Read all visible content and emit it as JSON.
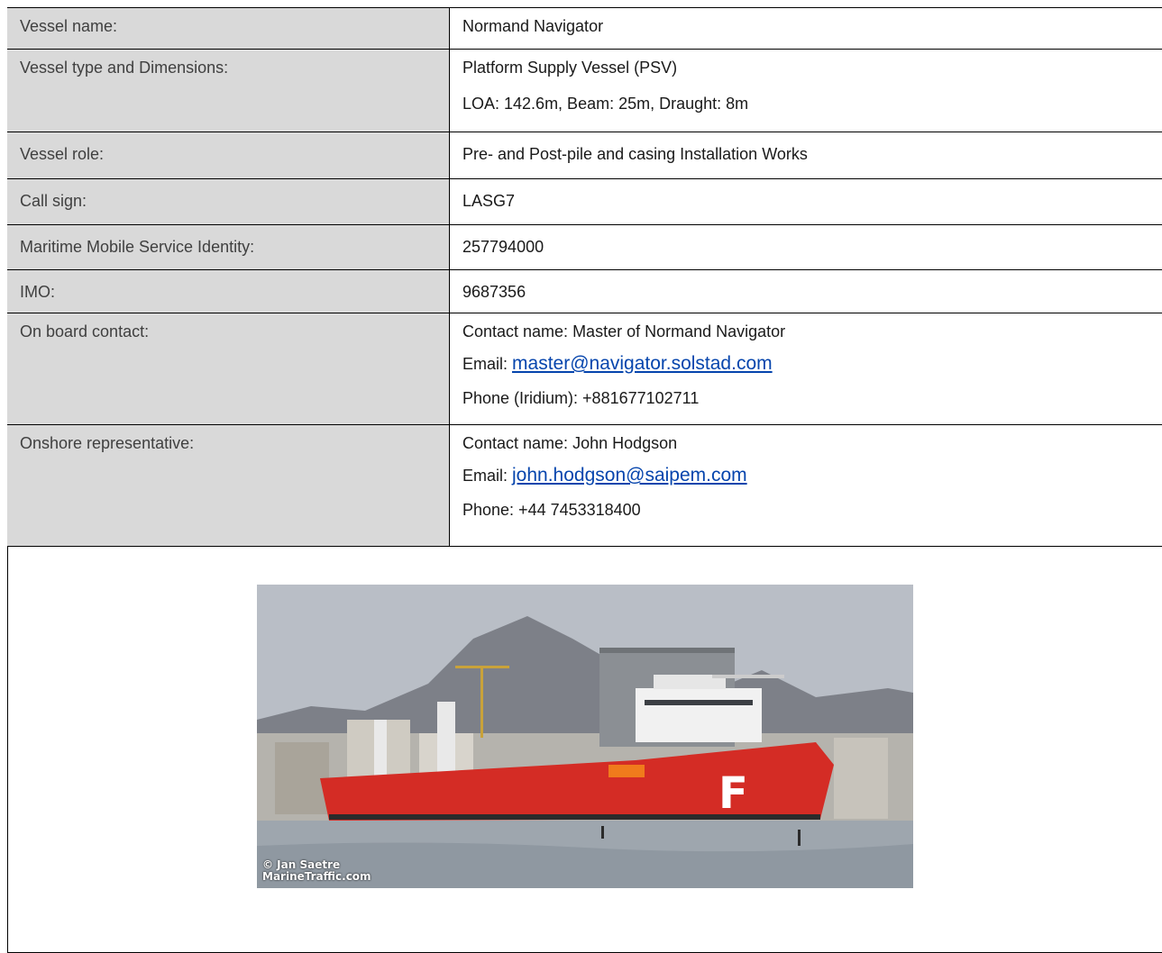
{
  "rows": [
    {
      "label": "Vessel name:",
      "lines": [
        "Normand Navigator"
      ]
    },
    {
      "label": "Vessel type and Dimensions:",
      "lines": [
        "Platform Supply Vessel (PSV)",
        "LOA: 142.6m, Beam: 25m, Draught: 8m"
      ]
    },
    {
      "label": "Vessel role:",
      "lines": [
        "Pre- and Post-pile and casing Installation Works"
      ]
    },
    {
      "label": "Call sign:",
      "lines": [
        "LASG7"
      ]
    },
    {
      "label": "Maritime Mobile Service Identity:",
      "lines": [
        "257794000"
      ]
    },
    {
      "label": "IMO:",
      "lines": [
        "9687356"
      ]
    }
  ],
  "onboard": {
    "label": "On board contact:",
    "contact": "Contact name: Master of Normand Navigator",
    "email_prefix": "Email: ",
    "email": "master@navigator.solstad.com",
    "phone": "Phone (Iridium): +881677102711"
  },
  "onshore": {
    "label": "Onshore representative:",
    "contact": "Contact name: John Hodgson",
    "email_prefix": "Email: ",
    "email": "john.hodgson@saipem.com",
    "phone": "Phone: +44 7453318400"
  },
  "photo": {
    "credit_line1": "© Jan Saetre",
    "credit_line2": "MarineTraffic.com",
    "hull_letter": "F"
  }
}
